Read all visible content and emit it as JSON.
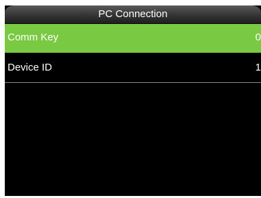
{
  "header": {
    "title": "PC Connection"
  },
  "menu": {
    "items": [
      {
        "label": "Comm Key",
        "value": "0"
      },
      {
        "label": "Device ID",
        "value": "1"
      }
    ]
  },
  "colors": {
    "selected_row": "#7ac943",
    "background": "#000000",
    "text": "#ffffff"
  }
}
